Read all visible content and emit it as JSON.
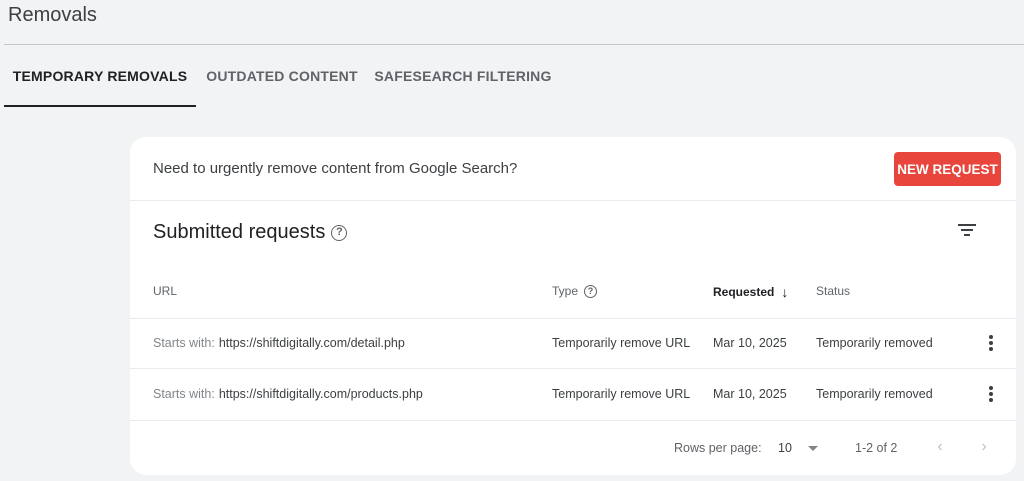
{
  "page": {
    "title": "Removals"
  },
  "tabs": [
    {
      "label": "TEMPORARY REMOVALS",
      "active": true
    },
    {
      "label": "OUTDATED CONTENT",
      "active": false
    },
    {
      "label": "SAFESEARCH FILTERING",
      "active": false
    }
  ],
  "banner": {
    "text": "Need to urgently remove content from Google Search?",
    "button_label": "NEW REQUEST",
    "button_color": "#e8453c"
  },
  "section": {
    "title": "Submitted requests",
    "help_icon": "help-icon",
    "filter_icon": "filter-icon"
  },
  "table": {
    "headers": {
      "url": "URL",
      "type": "Type",
      "requested": "Requested",
      "status": "Status"
    },
    "sort": {
      "column": "requested",
      "direction": "descending"
    },
    "rows": [
      {
        "prefix": "Starts with:",
        "url": "https://shiftdigitally.com/detail.php",
        "type": "Temporarily remove URL",
        "requested": "Mar 10, 2025",
        "status": "Temporarily removed"
      },
      {
        "prefix": "Starts with:",
        "url": "https://shiftdigitally.com/products.php",
        "type": "Temporarily remove URL",
        "requested": "Mar 10, 2025",
        "status": "Temporarily removed"
      }
    ]
  },
  "pagination": {
    "rows_per_page_label": "Rows per page:",
    "rows_per_page_value": "10",
    "range": "1-2 of 2"
  }
}
